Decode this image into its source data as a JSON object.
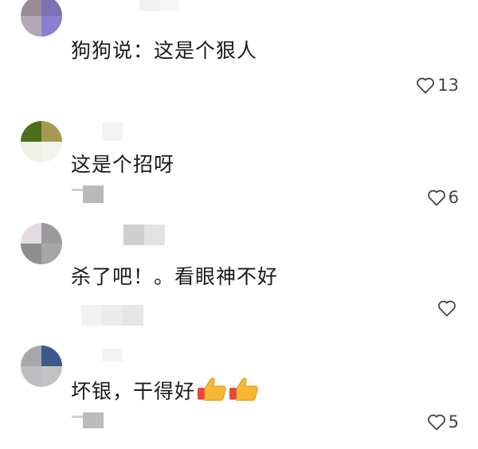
{
  "comments": [
    {
      "text": "狗狗说：这是个狠人",
      "likes": "13",
      "liked": false
    },
    {
      "text": "这是个招呀",
      "likes": "6",
      "liked": false
    },
    {
      "text": "杀了吧！。看眼神不好",
      "likes": "",
      "liked": false
    },
    {
      "text": "坏银，干得好",
      "likes": "5",
      "liked": false,
      "emojis": [
        "thumbs-up",
        "thumbs-up"
      ]
    }
  ],
  "colors": {
    "text": "#1a1a1a",
    "like_icon": "#444444",
    "emoji_yellow": "#f7b733",
    "emoji_red": "#e8453c"
  }
}
